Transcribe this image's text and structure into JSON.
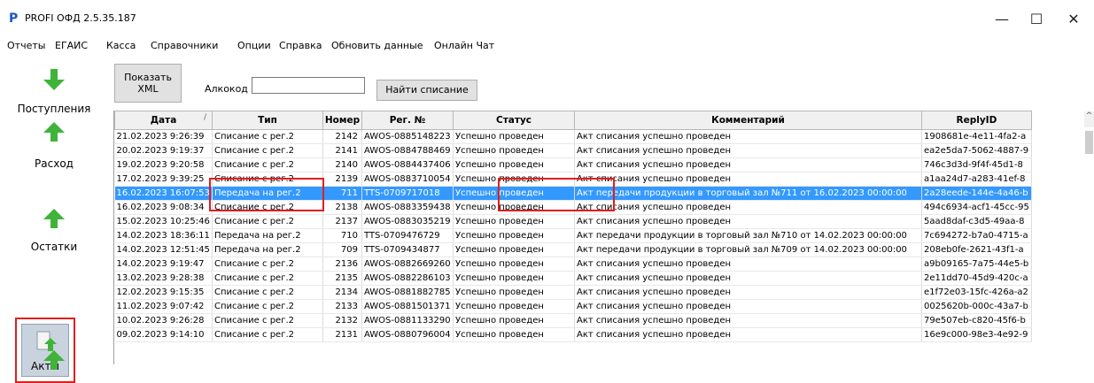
{
  "window": {
    "title": "PROFI ОФД 2.5.35.187",
    "logo_glyph": "P",
    "minimize_glyph": "—",
    "maximize_glyph": "☐",
    "close_glyph": "✕"
  },
  "menu": [
    "Отчеты",
    "ЕГАИС",
    "Касса",
    "Справочники",
    "Опции",
    "Справка",
    "Обновить данные",
    "Онлайн Чат"
  ],
  "sidebar": {
    "items": [
      {
        "label": "Поступления",
        "icon": "arrow-down-icon"
      },
      {
        "label": "Расход",
        "icon": "arrow-up-icon"
      },
      {
        "label": "Остатки",
        "icon": "arrow-up-icon"
      },
      {
        "label": "Акты",
        "icon": "document-arrow-icon"
      }
    ],
    "active": "Акты"
  },
  "toolbar": {
    "xml_label": "Показать XML",
    "alcocode_label": "Алкокод",
    "alcocode_value": "",
    "find_label": "Найти списание"
  },
  "colors": {
    "selection": "#3399ff",
    "highlight": "#e01e1e",
    "icon_green": "#3fb33a"
  },
  "table": {
    "columns": [
      "Дата",
      "Тип",
      "Номер",
      "Рег. №",
      "Статус",
      "Комментарий",
      "ReplyID"
    ],
    "selected_row": 4,
    "rows": [
      [
        "21.02.2023 9:26:39",
        "Списание с рег.2",
        "2142",
        "AWOS-0885148223",
        "Успешно проведен",
        "Акт списания успешно проведен",
        "1908681e-4e11-4fa2-a"
      ],
      [
        "20.02.2023 9:19:37",
        "Списание с рег.2",
        "2141",
        "AWOS-0884788469",
        "Успешно проведен",
        "Акт списания успешно проведен",
        "ea2e5da7-5062-4887-9"
      ],
      [
        "19.02.2023 9:20:58",
        "Списание с рег.2",
        "2140",
        "AWOS-0884437406",
        "Успешно проведен",
        "Акт списания успешно проведен",
        "746c3d3d-9f4f-45d1-8"
      ],
      [
        "17.02.2023 9:39:25",
        "Списание с рег.2",
        "2139",
        "AWOS-0883710054",
        "Успешно проведен",
        "Акт списания успешно проведен",
        "a1aa24d7-a283-41ef-8"
      ],
      [
        "16.02.2023 16:07:53",
        "Передача на рег.2",
        "711",
        "TTS-0709717018",
        "Успешно проведен",
        "Акт передачи продукции в торговый зал №711 от 16.02.2023 00:00:00",
        "2a28eede-144e-4a46-b"
      ],
      [
        "16.02.2023 9:08:34",
        "Списание с рег.2",
        "2138",
        "AWOS-0883359438",
        "Успешно проведен",
        "Акт списания успешно проведен",
        "494c6934-acf1-45cc-95"
      ],
      [
        "15.02.2023 10:25:46",
        "Списание с рег.2",
        "2137",
        "AWOS-0883035219",
        "Успешно проведен",
        "Акт списания успешно проведен",
        "5aad8daf-c3d5-49aa-8"
      ],
      [
        "14.02.2023 18:36:11",
        "Передача на рег.2",
        "710",
        "TTS-0709476729",
        "Успешно проведен",
        "Акт передачи продукции в торговый зал №710 от 14.02.2023 00:00:00",
        "7c694272-b7a0-4715-a"
      ],
      [
        "14.02.2023 12:51:45",
        "Передача на рег.2",
        "709",
        "TTS-0709434877",
        "Успешно проведен",
        "Акт передачи продукции в торговый зал №709 от 14.02.2023 00:00:00",
        "208eb0fe-2621-43f1-a"
      ],
      [
        "14.02.2023 9:19:47",
        "Списание с рег.2",
        "2136",
        "AWOS-0882669260",
        "Успешно проведен",
        "Акт списания успешно проведен",
        "a9b09165-7a75-44e5-b"
      ],
      [
        "13.02.2023 9:28:38",
        "Списание с рег.2",
        "2135",
        "AWOS-0882286103",
        "Успешно проведен",
        "Акт списания успешно проведен",
        "2e11dd70-45d9-420c-a"
      ],
      [
        "12.02.2023 9:15:35",
        "Списание с рег.2",
        "2134",
        "AWOS-0881882785",
        "Успешно проведен",
        "Акт списания успешно проведен",
        "e1f72e03-15fc-426a-a2"
      ],
      [
        "11.02.2023 9:07:42",
        "Списание с рег.2",
        "2133",
        "AWOS-0881501371",
        "Успешно проведен",
        "Акт списания успешно проведен",
        "0025620b-000c-43a7-b"
      ],
      [
        "10.02.2023 9:26:28",
        "Списание с рег.2",
        "2132",
        "AWOS-0881133290",
        "Успешно проведен",
        "Акт списания успешно проведен",
        "79e507eb-c820-45f6-b"
      ],
      [
        "09.02.2023 9:14:10",
        "Списание с рег.2",
        "2131",
        "AWOS-0880796004",
        "Успешно проведен",
        "Акт списания успешно проведен",
        "16e9c000-98e3-4e92-9"
      ]
    ]
  }
}
